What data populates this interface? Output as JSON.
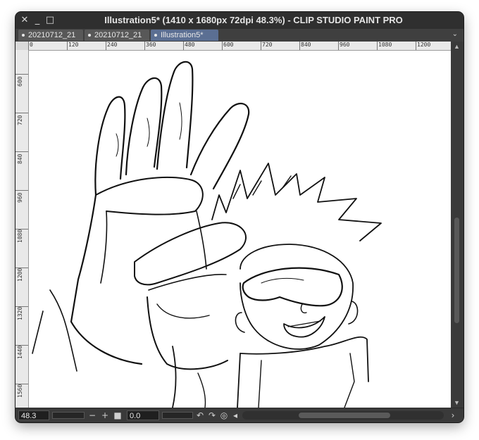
{
  "window": {
    "title": "Illustration5* (1410 x 1680px 72dpi 48.3%)  - CLIP STUDIO PAINT PRO"
  },
  "tabs": [
    {
      "label": "20210712_21",
      "active": false
    },
    {
      "label": "20210712_21",
      "active": false
    },
    {
      "label": "Illustration5*",
      "active": true
    }
  ],
  "ruler_h": [
    "0",
    "120",
    "240",
    "360",
    "480",
    "600",
    "720",
    "840",
    "960",
    "1080",
    "1200"
  ],
  "ruler_v": [
    "600",
    "720",
    "840",
    "960",
    "1080",
    "1200",
    "1320",
    "1440",
    "1560"
  ],
  "bottombar": {
    "zoom": "48.3",
    "angle": "0.0"
  },
  "icons": {
    "close": "close-icon",
    "minimize": "minimize-icon",
    "maximize": "maximize-icon",
    "zoom_out": "minus-icon",
    "zoom_in": "plus-icon",
    "fit": "square-icon",
    "rotate_left": "rotate-left-icon",
    "rotate_right": "rotate-right-icon",
    "reset_rotation": "reset-rotation-icon",
    "flip": "flip-icon"
  },
  "colors": {
    "active_tab": "#5b6f93",
    "window_bg": "#3b3b3b"
  }
}
